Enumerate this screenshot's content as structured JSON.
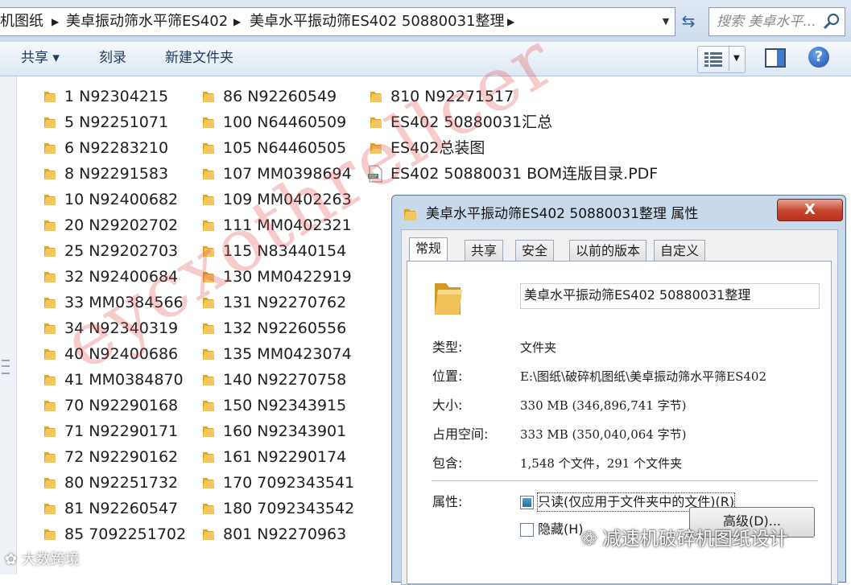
{
  "breadcrumbs": [
    "机图纸",
    "美卓振动筛水平筛ES402",
    "美卓水平振动筛ES402 50880031整理"
  ],
  "search": {
    "placeholder": "搜索 美卓水平..."
  },
  "toolbar": {
    "share": "共享 ▾",
    "burn": "刻录",
    "new_folder": "新建文件夹"
  },
  "icons": {
    "search": "search-icon",
    "refresh": "refresh-icon",
    "help": "help-icon",
    "folder": "folder-icon",
    "pdf": "pdf-file-icon"
  },
  "colors": {
    "folder": "#e8b33a",
    "close": "#c5432c",
    "watermark": "#e14646"
  },
  "files": {
    "col1": [
      "1   N92304215",
      "5   N92251071",
      "6   N92283210",
      "8   N92291583",
      "10 N92400682",
      "20 N29202702",
      "25 N29202703",
      "32 N92400684",
      "33 MM0384566",
      "34 N92340319",
      "40 N92400686",
      "41 MM0384870",
      "70 N92290168",
      "71 N92290171",
      "72 N92290162",
      "80 N92251732",
      "81 N92260547",
      "85 7092251702"
    ],
    "col2": [
      "86 N92260549",
      "100 N64460509",
      "105 N64460505",
      "107 MM0398694",
      "109 MM0402263",
      "111 MM0402321",
      "115 N83440154",
      "130 MM0422919",
      "131 N92270762",
      "132 N92260556",
      "135 MM0423074",
      "140 N92270758",
      "150 N92343915",
      "160 N92343901",
      "161 N92290174",
      "170 7092343541",
      "180 7092343542",
      "801 N92270963"
    ],
    "col3": [
      "810 N92271517",
      "ES402 50880031汇总",
      "ES402总装图"
    ],
    "pdf": "ES402  50880031 BOM连版目录.PDF"
  },
  "dialog": {
    "title": "美卓水平振动筛ES402 50880031整理 属性",
    "close": "X",
    "tabs": [
      "常规",
      "共享",
      "安全",
      "以前的版本",
      "自定义"
    ],
    "name": "美卓水平振动筛ES402 50880031整理",
    "props": [
      {
        "label": "类型:",
        "value": "文件夹"
      },
      {
        "label": "位置:",
        "value": "E:\\图纸\\破碎机图纸\\美卓振动筛水平筛ES402"
      },
      {
        "label": "大小:",
        "value": "330 MB (346,896,741 字节)"
      },
      {
        "label": "占用空间:",
        "value": "333 MB (350,040,064 字节)"
      },
      {
        "label": "包含:",
        "value": "1,548 个文件，291 个文件夹"
      }
    ],
    "attr_label": "属性:",
    "readonly": "只读(仅应用于文件夹中的文件)(R)",
    "hidden": "隐藏(H)",
    "advanced": "高级(D)..."
  },
  "watermarks": {
    "diagonal": "eycxothrellcer",
    "brand": "减速机破碎机图纸设计",
    "brand2": "大数跨境"
  }
}
